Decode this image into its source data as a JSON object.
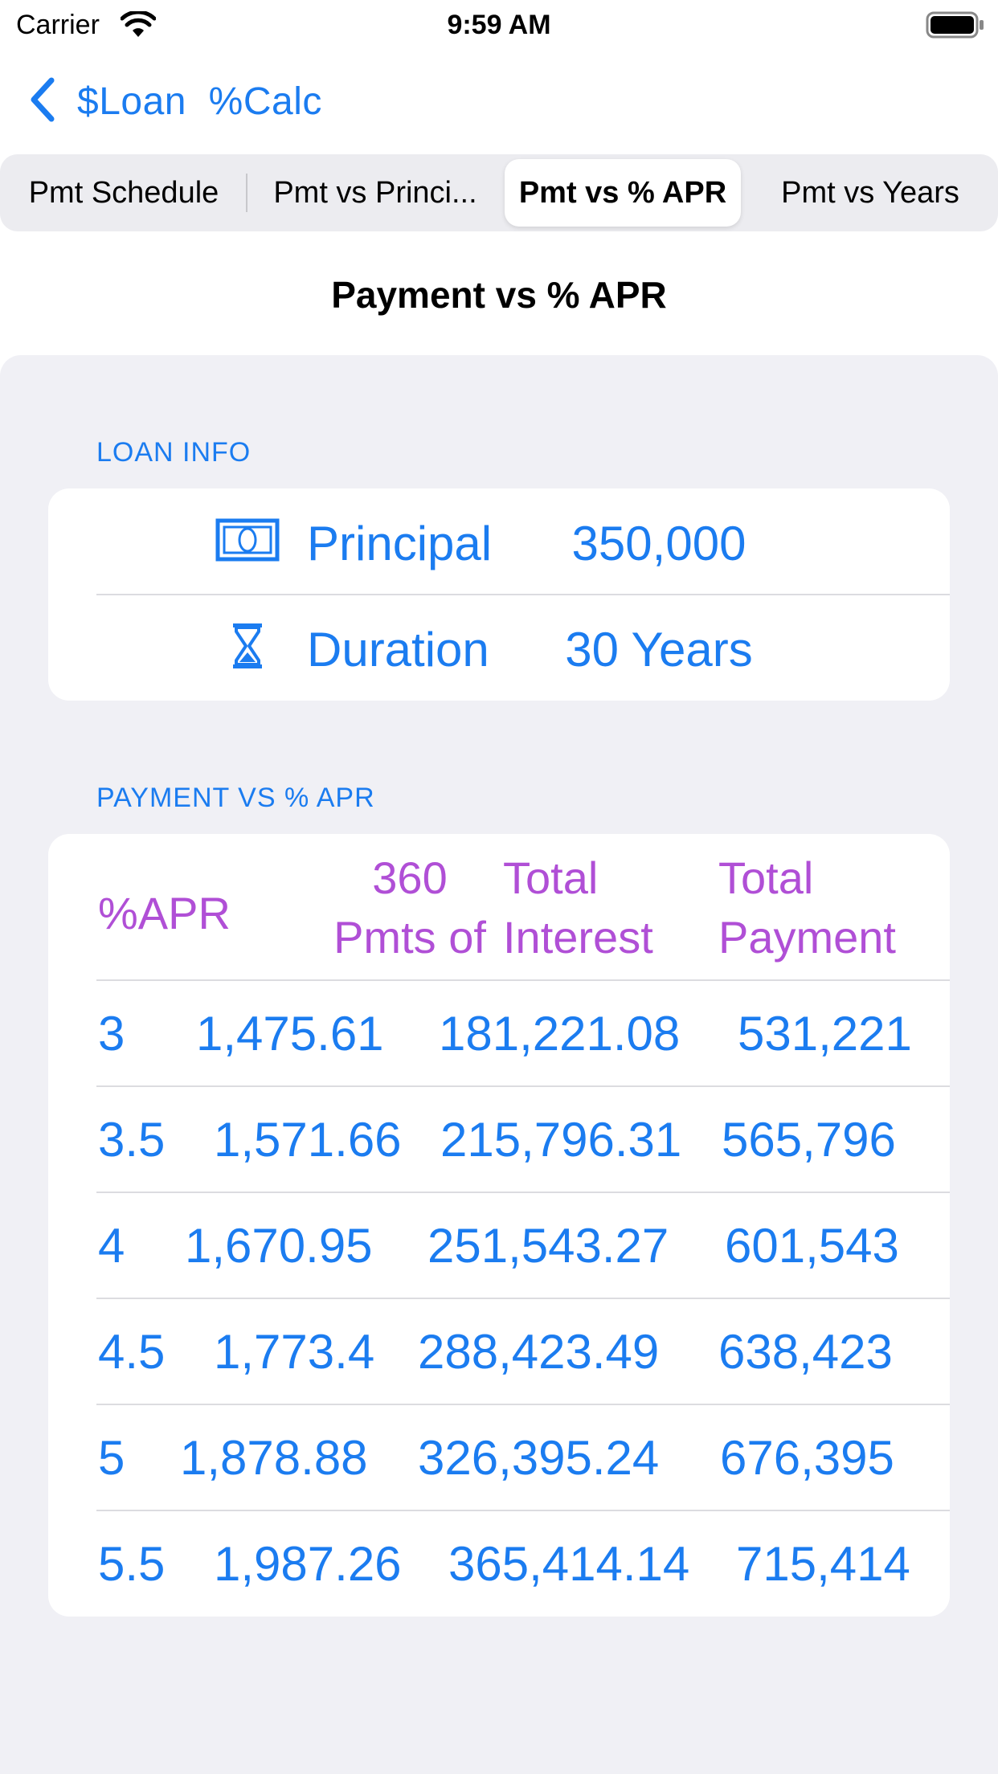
{
  "status_bar": {
    "carrier": "Carrier",
    "time": "9:59 AM"
  },
  "nav": {
    "back_label": "$Loan  %Calc"
  },
  "tabs": [
    {
      "label": "Pmt Schedule"
    },
    {
      "label": "Pmt vs Princi..."
    },
    {
      "label": "Pmt vs % APR",
      "selected": true
    },
    {
      "label": "Pmt vs Years"
    }
  ],
  "page": {
    "title": "Payment vs % APR"
  },
  "loan_info": {
    "header": "LOAN INFO",
    "principal_label": "Principal",
    "principal_value": "350,000",
    "duration_label": "Duration",
    "duration_value": "30 Years",
    "principal_icon": "banknote-icon",
    "duration_icon": "hourglass-icon"
  },
  "table": {
    "header": "PAYMENT VS % APR",
    "columns": {
      "apr": "%APR",
      "pmts_line1": "360",
      "pmts_line2": "Pmts of",
      "interest_line1": "Total",
      "interest_line2": "Interest",
      "payment_line1": "Total",
      "payment_line2": "Payment"
    },
    "rows": [
      {
        "apr": "3",
        "pmt": "1,475.61",
        "interest": "181,221.08",
        "total": "531,221"
      },
      {
        "apr": "3.5",
        "pmt": "1,571.66",
        "interest": "215,796.31",
        "total": "565,796"
      },
      {
        "apr": "4",
        "pmt": "1,670.95",
        "interest": "251,543.27",
        "total": "601,543"
      },
      {
        "apr": "4.5",
        "pmt": "1,773.4",
        "interest": "288,423.49",
        "total": "638,423"
      },
      {
        "apr": "5",
        "pmt": "1,878.88",
        "interest": "326,395.24",
        "total": "676,395"
      },
      {
        "apr": "5.5",
        "pmt": "1,987.26",
        "interest": "365,414.14",
        "total": "715,414"
      }
    ]
  },
  "colors": {
    "accent": "#1b7cf0",
    "header_purple": "#b04fd6",
    "grouped_bg": "#f0f0f5"
  }
}
